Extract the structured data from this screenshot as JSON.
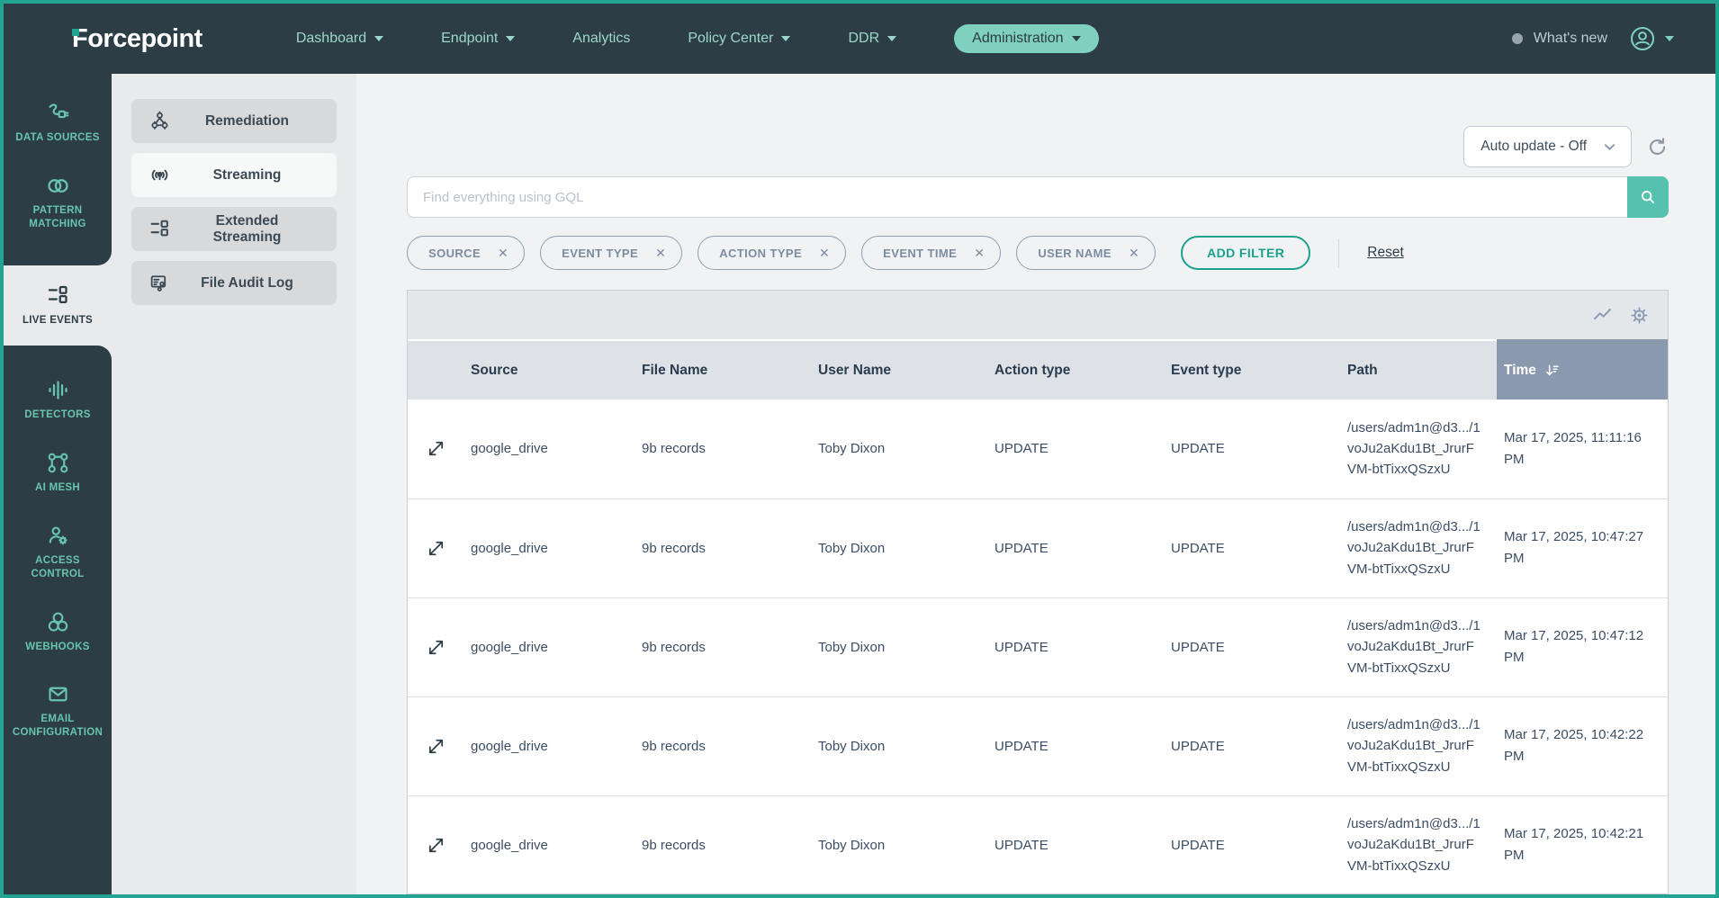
{
  "brand": {
    "logo": "Forcepoint"
  },
  "topnav": {
    "items": [
      {
        "label": "Dashboard"
      },
      {
        "label": "Endpoint"
      },
      {
        "label": "Analytics"
      },
      {
        "label": "Policy Center"
      },
      {
        "label": "DDR"
      },
      {
        "label": "Administration"
      }
    ],
    "whats_new": "What's new"
  },
  "sidebar": {
    "items": [
      {
        "label": "DATA SOURCES"
      },
      {
        "label": "PATTERN MATCHING"
      },
      {
        "label": "LIVE EVENTS"
      },
      {
        "label": "DETECTORS"
      },
      {
        "label": "AI MESH"
      },
      {
        "label": "ACCESS CONTROL"
      },
      {
        "label": "WEBHOOKS"
      },
      {
        "label": "EMAIL CONFIGURATION"
      }
    ]
  },
  "subnav": {
    "items": [
      {
        "label": "Remediation"
      },
      {
        "label": "Streaming"
      },
      {
        "label": "Extended Streaming"
      },
      {
        "label": "File Audit Log"
      }
    ]
  },
  "controls": {
    "auto_update": "Auto update - Off",
    "search_placeholder": "Find everything using GQL",
    "filters": [
      "SOURCE",
      "EVENT TYPE",
      "ACTION TYPE",
      "EVENT TIME",
      "USER NAME"
    ],
    "remove": "✕",
    "add_filter": "ADD FILTER",
    "reset": "Reset"
  },
  "table": {
    "headers": [
      "Source",
      "File Name",
      "User Name",
      "Action type",
      "Event type",
      "Path",
      "Time"
    ],
    "rows": [
      {
        "source": "google_drive",
        "file_name": "9b records",
        "user_name": "Toby Dixon",
        "action_type": "UPDATE",
        "event_type": "UPDATE",
        "path": "/users/adm1n@d3.../1voJu2aKdu1Bt_JrurFVM-btTixxQSzxU",
        "time": "Mar 17, 2025, 11:11:16 PM"
      },
      {
        "source": "google_drive",
        "file_name": "9b records",
        "user_name": "Toby Dixon",
        "action_type": "UPDATE",
        "event_type": "UPDATE",
        "path": "/users/adm1n@d3.../1voJu2aKdu1Bt_JrurFVM-btTixxQSzxU",
        "time": "Mar 17, 2025, 10:47:27 PM"
      },
      {
        "source": "google_drive",
        "file_name": "9b records",
        "user_name": "Toby Dixon",
        "action_type": "UPDATE",
        "event_type": "UPDATE",
        "path": "/users/adm1n@d3.../1voJu2aKdu1Bt_JrurFVM-btTixxQSzxU",
        "time": "Mar 17, 2025, 10:47:12 PM"
      },
      {
        "source": "google_drive",
        "file_name": "9b records",
        "user_name": "Toby Dixon",
        "action_type": "UPDATE",
        "event_type": "UPDATE",
        "path": "/users/adm1n@d3.../1voJu2aKdu1Bt_JrurFVM-btTixxQSzxU",
        "time": "Mar 17, 2025, 10:42:22 PM"
      },
      {
        "source": "google_drive",
        "file_name": "9b records",
        "user_name": "Toby Dixon",
        "action_type": "UPDATE",
        "event_type": "UPDATE",
        "path": "/users/adm1n@d3.../1voJu2aKdu1Bt_JrurFVM-btTixxQSzxU",
        "time": "Mar 17, 2025, 10:42:21 PM"
      }
    ]
  },
  "colors": {
    "accent_teal": "#23a492",
    "nav_dark": "#2c3d46",
    "nav_link": "#9cd8c9",
    "pill_bg": "#7fd0bf",
    "sidebar_icon": "#68c4ae",
    "chip_border": "#90a0b2",
    "add_filter": "#19a38c",
    "search_btn": "#56c1ae",
    "header_bg": "#dee2e6",
    "time_header_bg": "#8b99af"
  }
}
